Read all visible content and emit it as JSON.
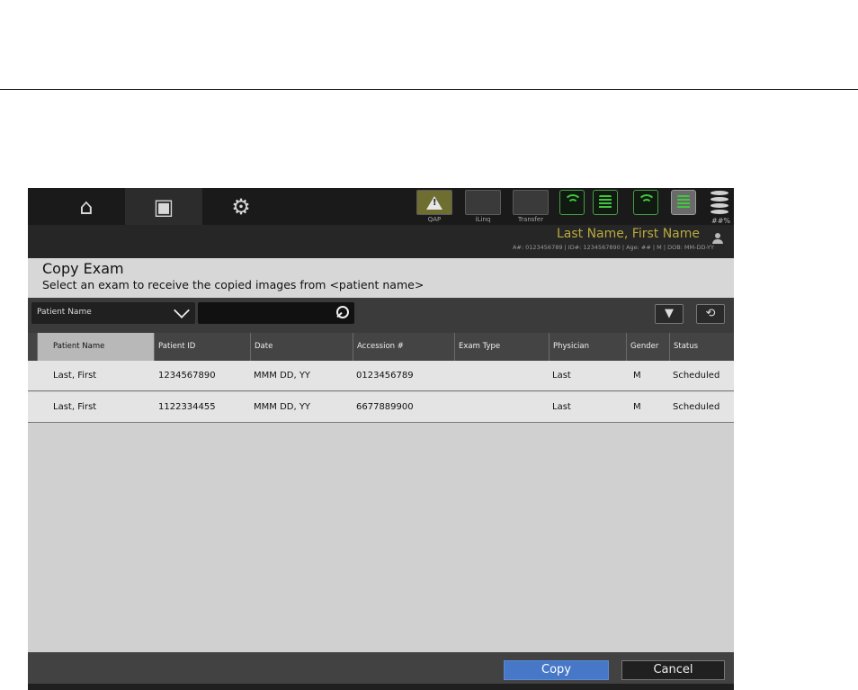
{
  "header": {
    "tabs": [
      {
        "icon": "home-icon",
        "glyph": "⌂"
      },
      {
        "icon": "patient-folder-icon",
        "glyph": "▣"
      },
      {
        "icon": "gear-icon",
        "glyph": "⚙"
      }
    ],
    "status_buttons": [
      {
        "label": "QAP",
        "icon": "warning-icon"
      },
      {
        "label": "iLinq",
        "icon": ""
      },
      {
        "label": "Transfer",
        "icon": ""
      }
    ],
    "storage_percent": "##%",
    "patient_name": "Last Name, First Name",
    "patient_info": "A#: 0123456789 | ID#: 1234567890 | Age: ## | M | DOB: MM-DD-YY"
  },
  "page": {
    "title": "Copy Exam",
    "subtitle": "Select an exam to receive the copied images from <patient name>"
  },
  "filter": {
    "field_selected": "Patient Name",
    "search_value": ""
  },
  "table": {
    "columns": [
      "Patient Name",
      "Patient ID",
      "Date",
      "Accession #",
      "Exam Type",
      "Physician",
      "Gender",
      "Status"
    ],
    "rows": [
      [
        "Last, First",
        "1234567890",
        "MMM DD, YY",
        "0123456789",
        "",
        "Last",
        "M",
        "Scheduled"
      ],
      [
        "Last, First",
        "1122334455",
        "MMM DD, YY",
        "6677889900",
        "",
        "Last",
        "M",
        "Scheduled"
      ]
    ]
  },
  "footer": {
    "copy_label": "Copy",
    "cancel_label": "Cancel"
  },
  "colors": {
    "accent_blue": "#4678c7",
    "patient_name_gold": "#b9a93e",
    "status_green": "#41c63f"
  }
}
